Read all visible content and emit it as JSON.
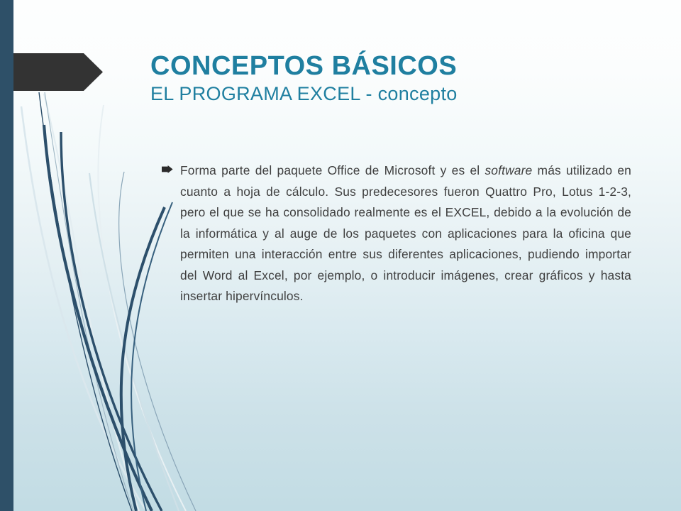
{
  "slide": {
    "title": "CONCEPTOS BÁSICOS",
    "subtitle": "EL PROGRAMA EXCEL - concepto",
    "bullets": [
      {
        "marker": "pennant-arrow-bullet-icon",
        "text_before_italic": "Forma parte del paquete Office de Microsoft y es el ",
        "italic_word": "software",
        "text_after_italic": " más utilizado en cuanto a hoja de cálculo. Sus predecesores fueron Quattro Pro, Lotus 1-2-3, pero el que se ha consolidado realmente es el EXCEL, debido a la evolución de la informática y al auge de los paquetes con aplicaciones para la oficina que permiten una interacción entre sus diferentes aplicaciones, pudiendo importar del Word al Excel, por ejemplo, o introducir imágenes, crear gráficos y hasta insertar hipervínculos."
      }
    ]
  },
  "decor": {
    "left_bar": "left-accent-bar",
    "arrow_banner": "dark-arrow-banner",
    "curves": "decorative-swoosh-curves"
  },
  "colors": {
    "accent_teal": "#1f7fa0",
    "left_bar_blue": "#2e5068",
    "banner_dark": "#333333",
    "body_text": "#3f3f3f",
    "bg_top": "#fdfefe",
    "bg_bottom": "#c2dce4",
    "curve_dark": "#2c4f6b",
    "curve_light": "#d5e2e8"
  }
}
